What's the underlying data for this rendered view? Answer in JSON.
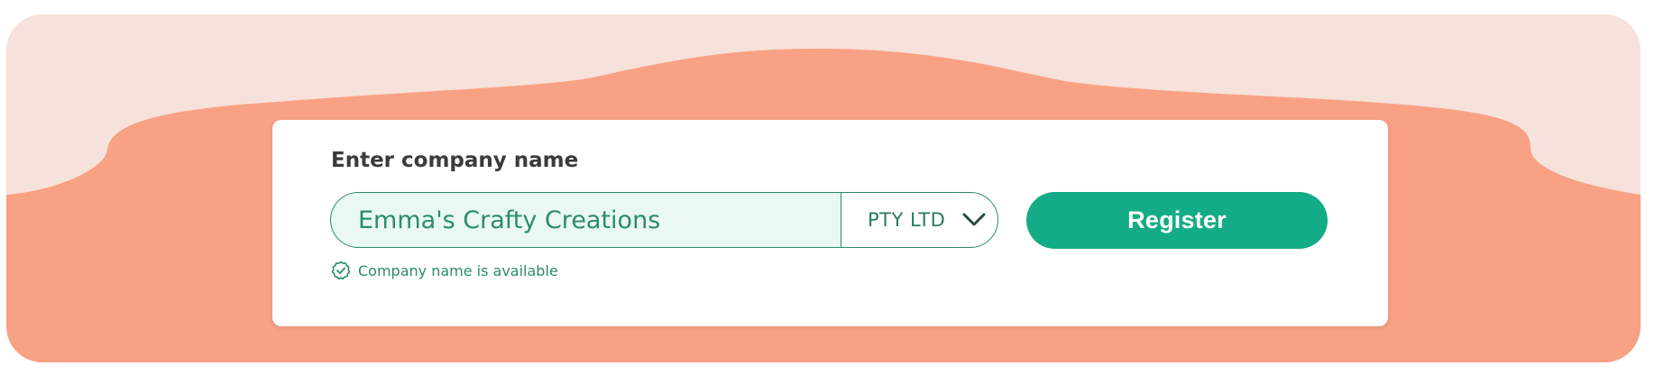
{
  "form": {
    "label": "Enter company name",
    "company_name_value": "Emma's Crafty Creations",
    "suffix_selected": "PTY LTD",
    "register_label": "Register",
    "availability_message": "Company name is available"
  },
  "icons": {
    "suffix_dropdown": "chevron-down-icon",
    "availability": "check-circle-icon"
  },
  "colors": {
    "banner_background": "#f6e2da",
    "banner_wave": "#f9a184",
    "input_fill": "#e9f8f3",
    "accent_green": "#14ac86",
    "status_green": "#2a8a6e"
  }
}
